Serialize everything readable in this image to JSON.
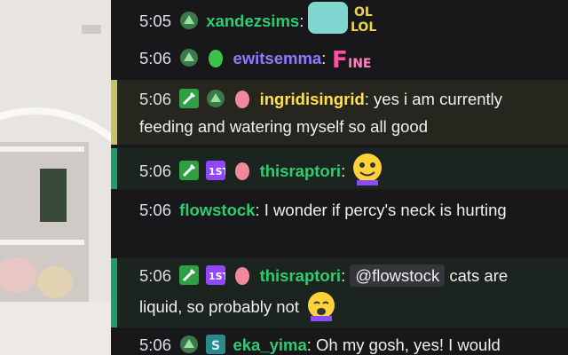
{
  "colors": {
    "chat_bg": "#18181b",
    "highlight_yellow": "#c7c26a",
    "highlight_green": "#1f9e6a"
  },
  "messages": [
    {
      "time": "5:05",
      "user": "xandezsims",
      "sep": ":",
      "text": "",
      "user_color": "#2ecc71",
      "badges": [
        "dino-badge"
      ],
      "emote": "lol-dino-emote"
    },
    {
      "time": "5:06",
      "user": "ewitsemma",
      "sep": ":",
      "text": "",
      "user_color": "#8a7cff",
      "badges": [
        "dino-badge",
        "green-egg-badge"
      ],
      "emote": "fine-emote"
    },
    {
      "time": "5:06",
      "user": "ingridisingrid",
      "sep": ":",
      "text": " yes i am currently feeding and watering myself so all good",
      "user_color": "#ffe14d",
      "badges": [
        "sword-badge",
        "dino-badge",
        "egg-badge"
      ],
      "highlight": "yellow"
    },
    {
      "time": "5:06",
      "user": "thisraptori",
      "sep": ":",
      "text": "",
      "user_color": "#2ecc71",
      "badges": [
        "sword-badge",
        "first-sub-badge",
        "egg-badge"
      ],
      "highlight": "green",
      "emote": "hype-emote"
    },
    {
      "time": "5:06",
      "user": "flowstock",
      "sep": ":",
      "text": " I wonder if percy's neck is hurting",
      "user_color": "#2ecc71",
      "badges": []
    },
    {
      "time": "5:06",
      "user": "thisraptori",
      "sep": ":",
      "mention": "@flowstock",
      "text": " cats are liquid, so probably not",
      "user_color": "#2ecc71",
      "badges": [
        "sword-badge",
        "first-sub-badge",
        "egg-badge"
      ],
      "highlight": "green",
      "emote": "cat-emote"
    },
    {
      "time": "5:06",
      "user": "eka_yima",
      "sep": ":",
      "text": " Oh my gosh, yes! I would",
      "user_color": "#2ecc71",
      "badges": [
        "dino-badge",
        "s-badge"
      ]
    }
  ]
}
